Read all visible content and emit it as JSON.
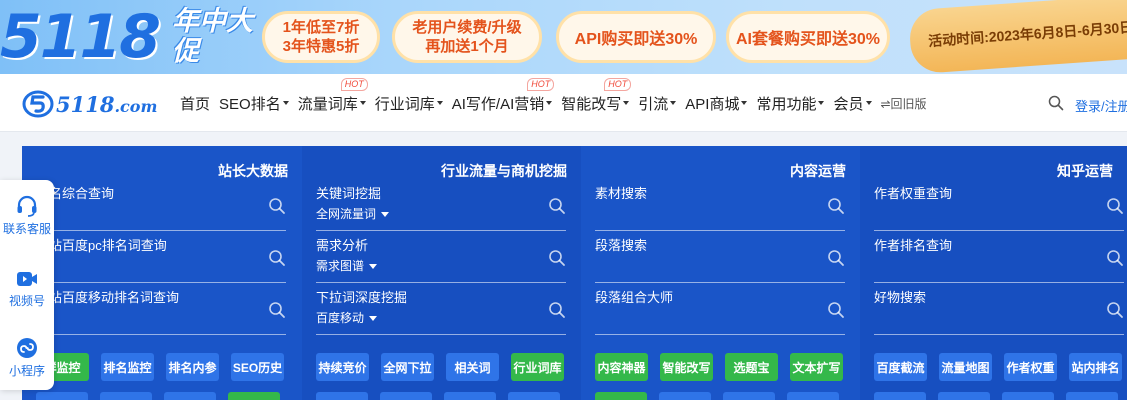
{
  "banner": {
    "big_logo": "5118",
    "sub_title": "年中大促",
    "promos": [
      {
        "line1": "1年低至7折",
        "line2": "3年特惠5折"
      },
      {
        "line1": "老用户续费/升级",
        "line2": "再加送1个月"
      },
      {
        "line1": "API购买即送30%"
      },
      {
        "line1": "AI套餐购买即送30%"
      }
    ],
    "activity_time": "活动时间:2023年6月8日-6月30日"
  },
  "nav": {
    "logo_text": "5118",
    "logo_suffix": ".com",
    "menu": [
      {
        "label": "首页",
        "caret": false,
        "hot": ""
      },
      {
        "label": "SEO排名",
        "caret": true,
        "hot": ""
      },
      {
        "label": "流量词库",
        "caret": true,
        "hot": "HOT"
      },
      {
        "label": "行业词库",
        "caret": true,
        "hot": ""
      },
      {
        "label": "AI写作/AI营销",
        "caret": true,
        "hot": "HOT"
      },
      {
        "label": "智能改写",
        "caret": true,
        "hot": "HOT"
      },
      {
        "label": "引流",
        "caret": true,
        "hot": ""
      },
      {
        "label": "API商城",
        "caret": true,
        "hot": ""
      },
      {
        "label": "常用功能",
        "caret": true,
        "hot": ""
      },
      {
        "label": "会员",
        "caret": true,
        "hot": ""
      }
    ],
    "back_old": "⇌回旧版",
    "login": "登录/注册"
  },
  "panels": [
    {
      "title": "站长大数据",
      "rows": [
        {
          "label": "站名综合查询",
          "select": ""
        },
        {
          "label": "网站百度pc排名词查询",
          "select": ""
        },
        {
          "label": "网站百度移动排名词查询",
          "select": ""
        }
      ],
      "tags": [
        {
          "label": "群监控",
          "color": "g"
        },
        {
          "label": "排名监控",
          "color": "b"
        },
        {
          "label": "排名内参",
          "color": "b"
        },
        {
          "label": "SEO历史",
          "color": "b"
        }
      ]
    },
    {
      "title": "行业流量与商机挖掘",
      "rows": [
        {
          "label": "关键词挖掘",
          "select": "全网流量词"
        },
        {
          "label": "需求分析",
          "select": "需求图谱"
        },
        {
          "label": "下拉词深度挖掘",
          "select": "百度移动"
        }
      ],
      "tags": [
        {
          "label": "持续竞价",
          "color": "b"
        },
        {
          "label": "全网下拉",
          "color": "b"
        },
        {
          "label": "相关词",
          "color": "b"
        },
        {
          "label": "行业词库",
          "color": "g"
        }
      ]
    },
    {
      "title": "内容运营",
      "rows": [
        {
          "label": "素材搜索",
          "select": ""
        },
        {
          "label": "段落搜索",
          "select": ""
        },
        {
          "label": "段落组合大师",
          "select": ""
        }
      ],
      "tags": [
        {
          "label": "内容神器",
          "color": "g"
        },
        {
          "label": "智能改写",
          "color": "g"
        },
        {
          "label": "选题宝",
          "color": "g"
        },
        {
          "label": "文本扩写",
          "color": "g"
        }
      ]
    },
    {
      "title": "知乎运营",
      "rows": [
        {
          "label": "作者权重查询",
          "select": ""
        },
        {
          "label": "作者排名查询",
          "select": ""
        },
        {
          "label": "好物搜索",
          "select": ""
        }
      ],
      "tags": [
        {
          "label": "百度截流",
          "color": "b"
        },
        {
          "label": "流量地图",
          "color": "b"
        },
        {
          "label": "作者权重",
          "color": "b"
        },
        {
          "label": "站内排名",
          "color": "b"
        }
      ]
    }
  ],
  "float_bar": [
    {
      "label": "联系客服",
      "icon": "headset-icon"
    },
    {
      "label": "视频号",
      "icon": "video-icon"
    },
    {
      "label": "小程序",
      "icon": "mini-program-icon"
    }
  ],
  "colors": {
    "brand": "#1f6fe0",
    "panel": "#1a55c8",
    "tag_green": "#34b84a",
    "tag_blue": "#2f74e8",
    "promo_text": "#e4531c"
  }
}
